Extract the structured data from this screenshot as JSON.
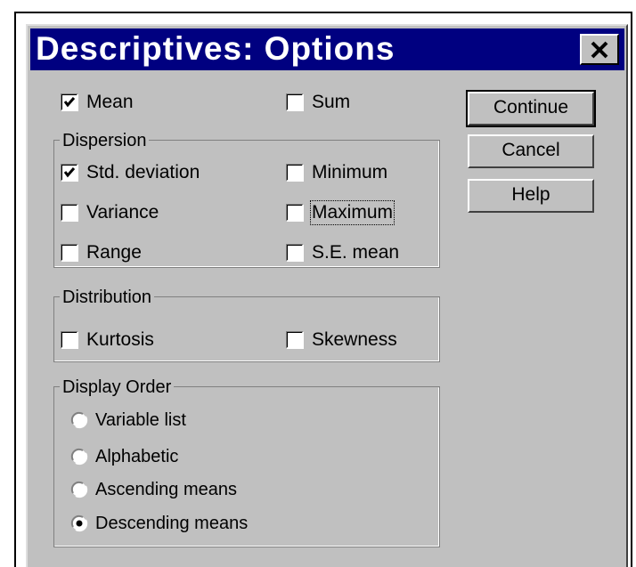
{
  "dialog": {
    "title": "Descriptives: Options",
    "close_glyph": "✕"
  },
  "options": {
    "mean": {
      "label": "Mean",
      "checked": true
    },
    "sum": {
      "label": "Sum",
      "checked": false
    }
  },
  "dispersion": {
    "title": "Dispersion",
    "std_deviation": {
      "label": "Std. deviation",
      "checked": true
    },
    "minimum": {
      "label": "Minimum",
      "checked": false
    },
    "variance": {
      "label": "Variance",
      "checked": false
    },
    "maximum": {
      "label": "Maximum",
      "checked": false
    },
    "range": {
      "label": "Range",
      "checked": false
    },
    "se_mean": {
      "label": "S.E. mean",
      "checked": false
    }
  },
  "distribution": {
    "title": "Distribution",
    "kurtosis": {
      "label": "Kurtosis",
      "checked": false
    },
    "skewness": {
      "label": "Skewness",
      "checked": false
    }
  },
  "display_order": {
    "title": "Display Order",
    "items": [
      {
        "label": "Variable list",
        "selected": false
      },
      {
        "label": "Alphabetic",
        "selected": false
      },
      {
        "label": "Ascending means",
        "selected": false
      },
      {
        "label": "Descending means",
        "selected": true
      }
    ]
  },
  "buttons": {
    "continue": "Continue",
    "cancel": "Cancel",
    "help": "Help"
  }
}
